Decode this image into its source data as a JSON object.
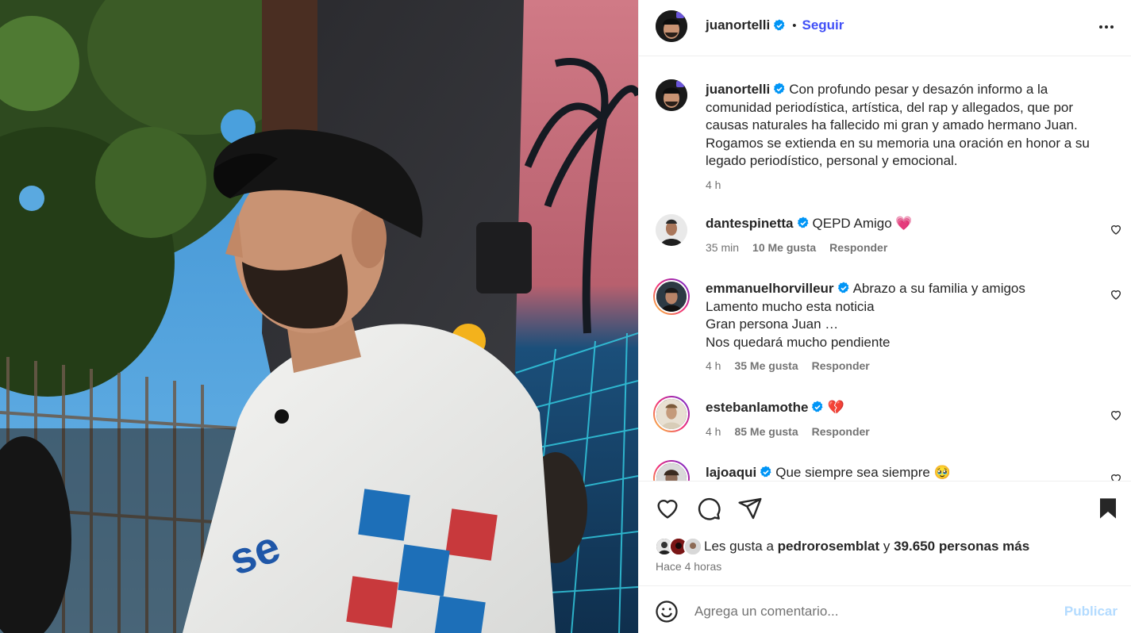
{
  "post": {
    "author": "juanortelli",
    "follow_label": "Seguir",
    "dot": "•",
    "caption": "Con profundo pesar y desazón informo a la comunidad periodística, artística, del rap y allegados, que por causas naturales ha fallecido mi gran y amado hermano Juan. Rogamos se extienda en su memoria una oración en honor a su legado periodístico, personal y emocional.",
    "caption_time": "4 h"
  },
  "comments": [
    {
      "user": "dantespinetta",
      "lines": [
        "QEPD Amigo 💗"
      ],
      "time": "35 min",
      "likes": "10 Me gusta",
      "reply": "Responder"
    },
    {
      "user": "emmanuelhorvilleur",
      "lines": [
        "Abrazo a su familia y amigos",
        "Lamento mucho esta noticia",
        "Gran persona Juan …",
        "Nos quedará mucho pendiente"
      ],
      "time": "4 h",
      "likes": "35 Me gusta",
      "reply": "Responder"
    },
    {
      "user": "estebanlamothe",
      "lines": [
        "💔"
      ],
      "time": "4 h",
      "likes": "85 Me gusta",
      "reply": "Responder"
    },
    {
      "user": "lajoaqui",
      "lines": [
        "Que siempre sea siempre 🥹"
      ],
      "time": "",
      "likes": "",
      "reply": ""
    }
  ],
  "likes_bar": {
    "prefix": "Les gusta a",
    "user": "pedrorosemblat",
    "connector": "y",
    "count": "39.650 personas más",
    "ago": "Hace 4 horas"
  },
  "composer": {
    "placeholder": "Agrega un comentario...",
    "publish_label": "Publicar"
  },
  "icons": {
    "like": "heart-icon",
    "comment": "comment-icon",
    "share": "share-icon",
    "save": "bookmark-icon",
    "emoji": "emoji-icon",
    "more": "more-icon",
    "verified": "verified-badge-icon"
  },
  "colors": {
    "accent": "#4150f7",
    "verified": "#0095f6",
    "muted": "#737373",
    "publish_disabled": "#b3dbff"
  }
}
